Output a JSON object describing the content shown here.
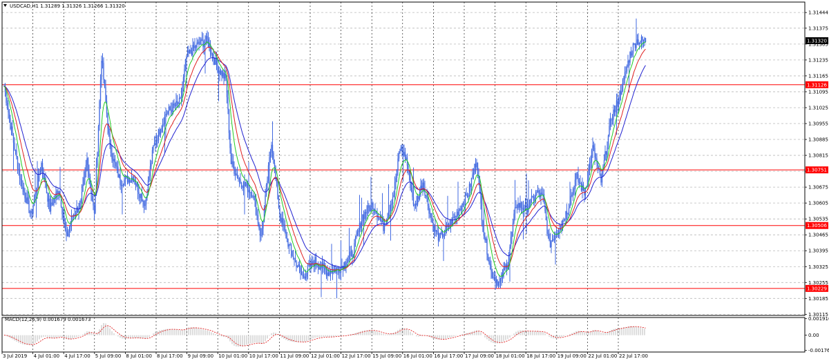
{
  "chart_data": [
    {
      "type": "candlestick",
      "title": "USDCAD,H1  1.31289 1.31326 1.31266 1.31320",
      "symbol": "USDCAD",
      "timeframe": "H1",
      "ohlc_header": "1.31289 1.31326 1.31266 1.31320",
      "x_tick_labels": [
        "3 Jul 2019",
        "4 Jul 01:00",
        "4 Jul 17:00",
        "5 Jul 09:00",
        "8 Jul 01:00",
        "8 Jul 17:00",
        "9 Jul 09:00",
        "10 Jul 01:00",
        "10 Jul 17:00",
        "11 Jul 09:00",
        "12 Jul 01:00",
        "12 Jul 17:00",
        "15 Jul 09:00",
        "16 Jul 01:00",
        "16 Jul 17:00",
        "17 Jul 09:00",
        "18 Jul 01:00",
        "18 Jul 17:00",
        "19 Jul 09:00",
        "22 Jul 01:00",
        "22 Jul 17:00"
      ],
      "y_tick_labels": [
        "1.31444",
        "1.31375",
        "1.31305",
        "1.31235",
        "1.31165",
        "1.31095",
        "1.31025",
        "1.30955",
        "1.30885",
        "1.30815",
        "1.30745",
        "1.30675",
        "1.30605",
        "1.30535",
        "1.30465",
        "1.30395",
        "1.30325",
        "1.30255",
        "1.30185",
        "1.30115"
      ],
      "ylim": [
        1.3011,
        1.3149
      ],
      "grid": true,
      "current_price_label": "1.31320",
      "levels": [
        {
          "label": "1.31126",
          "value": 1.31126,
          "color": "#ff0000"
        },
        {
          "label": "1.30751",
          "value": 1.30751,
          "color": "#ff0000"
        },
        {
          "label": "1.30506",
          "value": 1.30506,
          "color": "#ff0000"
        },
        {
          "label": "1.30229",
          "value": 1.30229,
          "color": "#ff0000"
        }
      ],
      "anchors": [
        [
          0,
          1.3112
        ],
        [
          6,
          1.3095
        ],
        [
          16,
          1.307
        ],
        [
          26,
          1.3055
        ],
        [
          36,
          1.3078
        ],
        [
          44,
          1.3058
        ],
        [
          53,
          1.3067
        ],
        [
          60,
          1.3045
        ],
        [
          66,
          1.3055
        ],
        [
          74,
          1.306
        ],
        [
          80,
          1.308
        ],
        [
          87,
          1.3055
        ],
        [
          94,
          1.3125
        ],
        [
          102,
          1.3085
        ],
        [
          112,
          1.307
        ],
        [
          124,
          1.3072
        ],
        [
          136,
          1.306
        ],
        [
          144,
          1.3085
        ],
        [
          156,
          1.31
        ],
        [
          170,
          1.3105
        ],
        [
          176,
          1.3125
        ],
        [
          186,
          1.313
        ],
        [
          196,
          1.3132
        ],
        [
          206,
          1.312
        ],
        [
          214,
          1.3115
        ],
        [
          219,
          1.3078
        ],
        [
          228,
          1.307
        ],
        [
          240,
          1.3065
        ],
        [
          248,
          1.3045
        ],
        [
          258,
          1.3088
        ],
        [
          266,
          1.3055
        ],
        [
          276,
          1.304
        ],
        [
          288,
          1.3028
        ],
        [
          300,
          1.3035
        ],
        [
          312,
          1.303
        ],
        [
          324,
          1.3032
        ],
        [
          336,
          1.3038
        ],
        [
          346,
          1.3055
        ],
        [
          356,
          1.306
        ],
        [
          366,
          1.305
        ],
        [
          376,
          1.3065
        ],
        [
          382,
          1.3085
        ],
        [
          388,
          1.308
        ],
        [
          396,
          1.3058
        ],
        [
          404,
          1.307
        ],
        [
          414,
          1.305
        ],
        [
          420,
          1.3045
        ],
        [
          432,
          1.3052
        ],
        [
          448,
          1.3065
        ],
        [
          456,
          1.308
        ],
        [
          462,
          1.305
        ],
        [
          470,
          1.303
        ],
        [
          478,
          1.3025
        ],
        [
          486,
          1.3035
        ],
        [
          494,
          1.306
        ],
        [
          504,
          1.3058
        ],
        [
          514,
          1.3065
        ],
        [
          520,
          1.3063
        ],
        [
          526,
          1.3042
        ],
        [
          536,
          1.305
        ],
        [
          544,
          1.3058
        ],
        [
          552,
          1.3072
        ],
        [
          560,
          1.3065
        ],
        [
          568,
          1.3085
        ],
        [
          576,
          1.307
        ],
        [
          586,
          1.3098
        ],
        [
          592,
          1.3105
        ],
        [
          598,
          1.3115
        ],
        [
          604,
          1.3126
        ],
        [
          610,
          1.3132
        ]
      ],
      "macd": {
        "label": "MACD(12,26,9) 0.001679 0.001673",
        "y_tick_labels": [
          "0.001916",
          "0.00",
          "-0.001768"
        ],
        "ylim": [
          -0.00195,
          0.00205
        ]
      },
      "colors": {
        "candle": "#4169e1",
        "ma_fast": "#22cc22",
        "ma_mid": "#e02020",
        "ma_slow": "#2020d0",
        "grid": "#b8b8b8",
        "level": "#ff0000",
        "macd_hist": "#b4b4b4",
        "macd_signal": "#e02020",
        "price_label_bg": "#000000"
      }
    }
  ]
}
